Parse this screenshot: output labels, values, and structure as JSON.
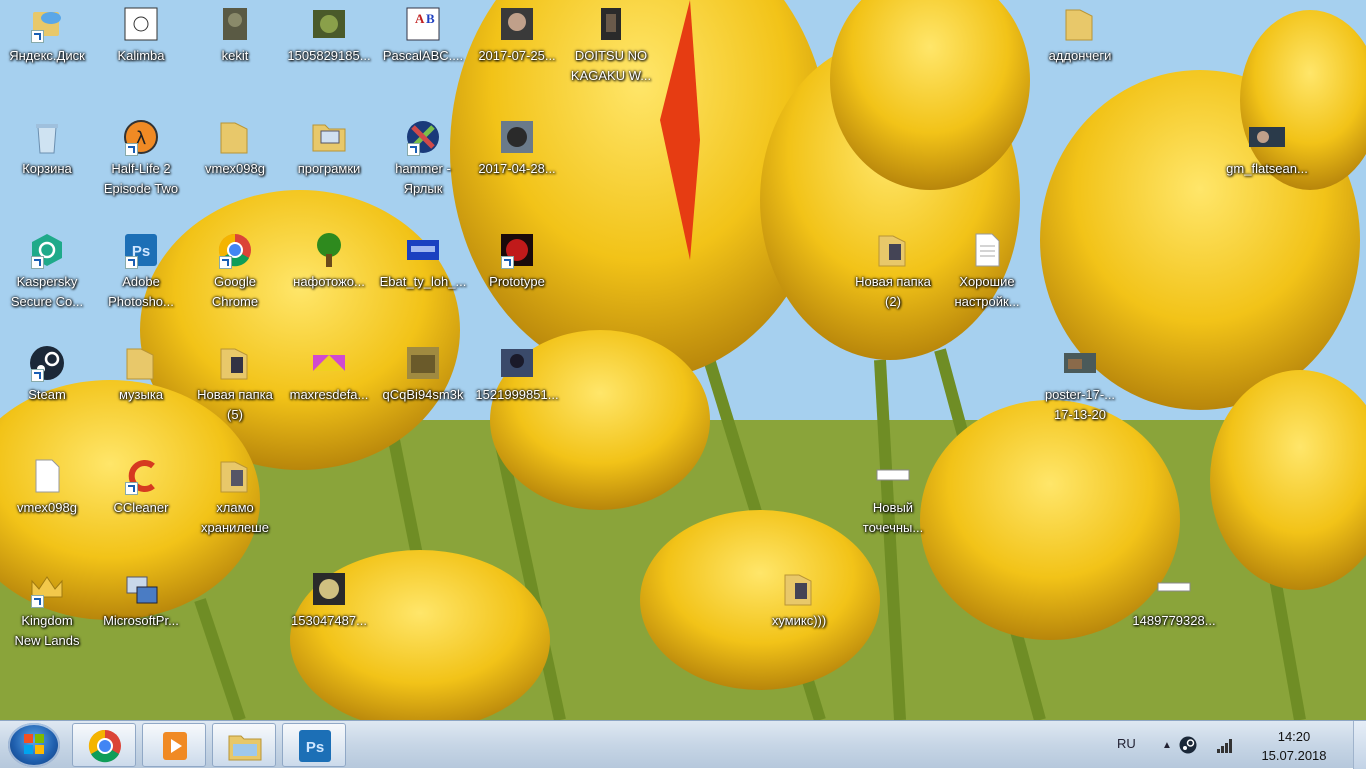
{
  "desktop_icons": [
    {
      "label": "Яндекс.Диск",
      "icon": "yandex-disk-icon"
    },
    {
      "label": "Kalimba",
      "icon": "kalimba-icon"
    },
    {
      "label": "kekit",
      "icon": "kekit-image-icon"
    },
    {
      "label": "1505829185...",
      "icon": "image-thumbnail-icon"
    },
    {
      "label": "PascalABC....",
      "icon": "pascalabc-icon"
    },
    {
      "label": "2017-07-25...",
      "icon": "image-thumbnail-icon"
    },
    {
      "label": "DOITSU NO\nKAGAKU W...",
      "icon": "image-thumbnail-icon"
    },
    {
      "label": "аддончеги",
      "icon": "folder-icon"
    },
    {
      "label": "Корзина",
      "icon": "recycle-bin-icon"
    },
    {
      "label": "Half-Life 2\nEpisode Two",
      "icon": "half-life-icon"
    },
    {
      "label": "vmex098g",
      "icon": "folder-icon"
    },
    {
      "label": "програмки",
      "icon": "computer-folder-icon"
    },
    {
      "label": "hammer -\nЯрлык",
      "icon": "hammer-icon"
    },
    {
      "label": "2017-04-28...",
      "icon": "image-thumbnail-icon"
    },
    {
      "label": "gm_flatsean...",
      "icon": "image-thumbnail-icon"
    },
    {
      "label": "Kaspersky\nSecure Co...",
      "icon": "kaspersky-icon"
    },
    {
      "label": "Adobe\nPhotosho...",
      "icon": "photoshop-icon"
    },
    {
      "label": "Google\nChrome",
      "icon": "chrome-icon"
    },
    {
      "label": "нафотожо...",
      "icon": "tree-image-icon"
    },
    {
      "label": "Ebat_ty_loh_...",
      "icon": "image-thumbnail-icon"
    },
    {
      "label": "Prototype",
      "icon": "prototype-icon"
    },
    {
      "label": "Новая папка\n(2)",
      "icon": "folder-icon"
    },
    {
      "label": "Хорошие\nнастройк...",
      "icon": "text-file-icon"
    },
    {
      "label": "Steam",
      "icon": "steam-icon"
    },
    {
      "label": "музыка",
      "icon": "folder-icon"
    },
    {
      "label": "Новая папка\n(5)",
      "icon": "folder-icon"
    },
    {
      "label": "maxresdefa...",
      "icon": "image-thumbnail-icon"
    },
    {
      "label": "qCqBi94sm3k",
      "icon": "image-thumbnail-icon"
    },
    {
      "label": "1521999851...",
      "icon": "image-thumbnail-icon"
    },
    {
      "label": "poster-17-...\n17-13-20",
      "icon": "image-thumbnail-icon"
    },
    {
      "label": "vmex098g",
      "icon": "blank-file-icon"
    },
    {
      "label": "CCleaner",
      "icon": "ccleaner-icon"
    },
    {
      "label": "хламо\nхранилеше",
      "icon": "folder-icon"
    },
    {
      "label": "Новый\nточечны...",
      "icon": "bitmap-icon"
    },
    {
      "label": "Kingdom\nNew Lands",
      "icon": "kingdom-icon"
    },
    {
      "label": "MicrosoftPr...",
      "icon": "microsoft-program-icon"
    },
    {
      "label": "153047487...",
      "icon": "image-thumbnail-icon"
    },
    {
      "label": "хумикс)))",
      "icon": "folder-icon"
    },
    {
      "label": "1489779328...",
      "icon": "bitmap-icon"
    }
  ],
  "taskbar": {
    "start": "windows-start-icon",
    "pinned": [
      {
        "name": "chrome",
        "icon": "chrome-icon"
      },
      {
        "name": "media-player",
        "icon": "media-player-icon"
      },
      {
        "name": "explorer",
        "icon": "explorer-folder-icon"
      },
      {
        "name": "photoshop",
        "icon": "photoshop-icon"
      }
    ],
    "tray": {
      "language": "RU",
      "time": "14:20",
      "date": "15.07.2018"
    }
  },
  "colors": {
    "taskbar": "#c7d6e6",
    "folder": "#e8c86a",
    "photoshop": "#1c6fb6",
    "steam": "#1b2838"
  }
}
